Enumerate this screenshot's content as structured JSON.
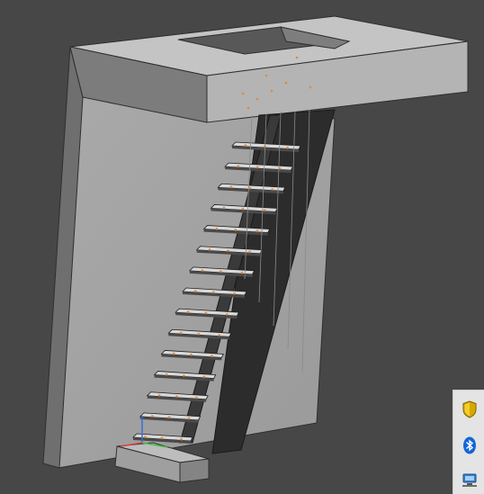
{
  "viewport": {
    "background": "#474747",
    "model": "staircase-3d-model"
  },
  "tray": {
    "icons": [
      "security-shield-icon",
      "bluetooth-icon",
      "network-icon"
    ]
  }
}
